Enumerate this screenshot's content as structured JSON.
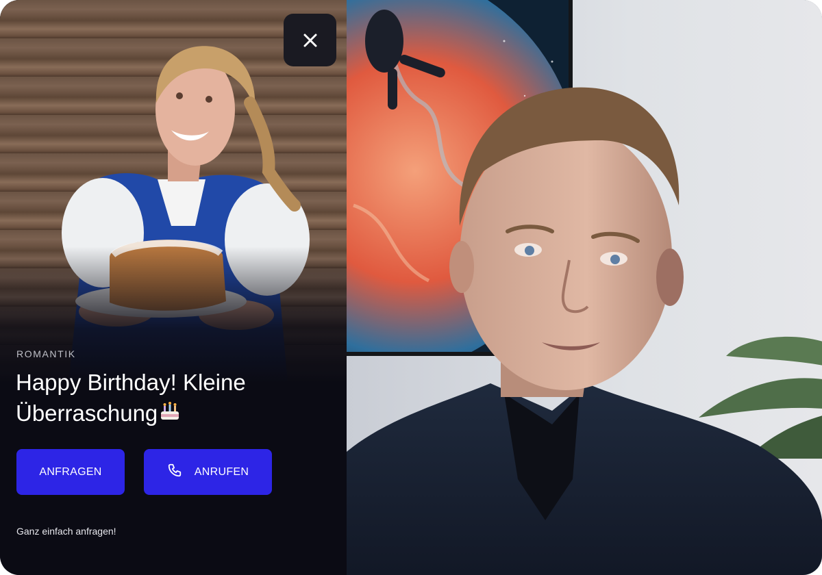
{
  "card": {
    "category": "ROMANTIK",
    "title": "Happy Birthday! Kleine Überraschung",
    "title_emoji": "cake-emoji",
    "buttons": {
      "request_label": "ANFRAGEN",
      "call_label": "ANRUFEN"
    },
    "footnote": "Ganz einfach anfragen!",
    "close_icon": "close-icon",
    "call_icon": "phone-icon"
  },
  "colors": {
    "card_background": "#0b0b14",
    "button_primary": "#2d25e6",
    "close_button": "#1a1a22",
    "text_primary": "#ffffff",
    "text_muted": "#bfc0c8"
  }
}
